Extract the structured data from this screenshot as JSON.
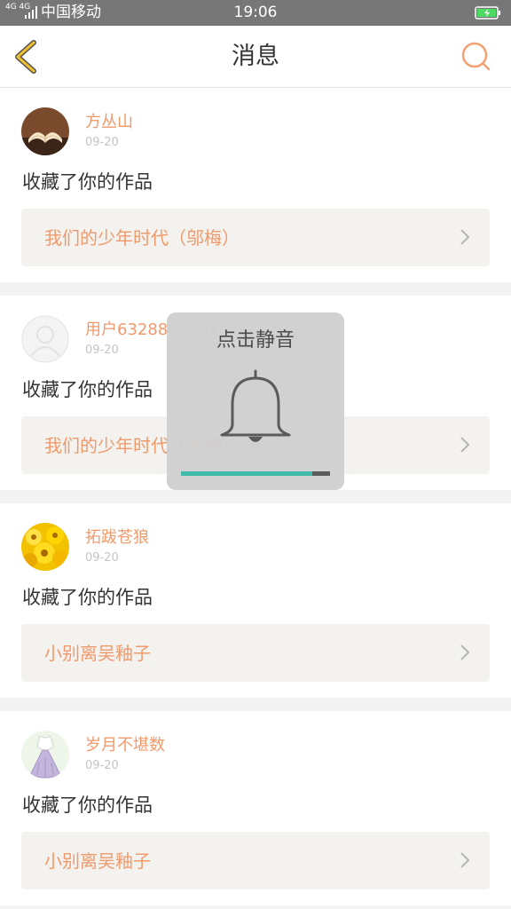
{
  "status_bar": {
    "network": "4G 4G",
    "carrier": "中国移动",
    "time": "19:06"
  },
  "nav": {
    "title": "消息",
    "back_icon": "chevron-left-icon",
    "search_icon": "search-icon"
  },
  "notifications": [
    {
      "username": "方丛山",
      "date": "09-20",
      "action": "收藏了你的作品",
      "work_title": "我们的少年时代（邬梅）",
      "avatar": "open-book-photo"
    },
    {
      "username": "用户6328802597",
      "date": "09-20",
      "action": "收藏了你的作品",
      "work_title": "我们的少年时代（邬梅）",
      "avatar": "default-avatar"
    },
    {
      "username": "拓跋苍狼",
      "date": "09-20",
      "action": "收藏了你的作品",
      "work_title": "小别离吴釉子",
      "avatar": "sunflower-photo"
    },
    {
      "username": "岁月不堪数",
      "date": "09-20",
      "action": "收藏了你的作品",
      "work_title": "小别离吴釉子",
      "avatar": "dress-illustration"
    }
  ],
  "volume_toast": {
    "label": "点击静音",
    "icon": "bell-icon",
    "level_percent": 88
  },
  "colors": {
    "accent": "#f09a6c",
    "nav_icon": "#f0c030",
    "volume": "#39b8a6"
  }
}
